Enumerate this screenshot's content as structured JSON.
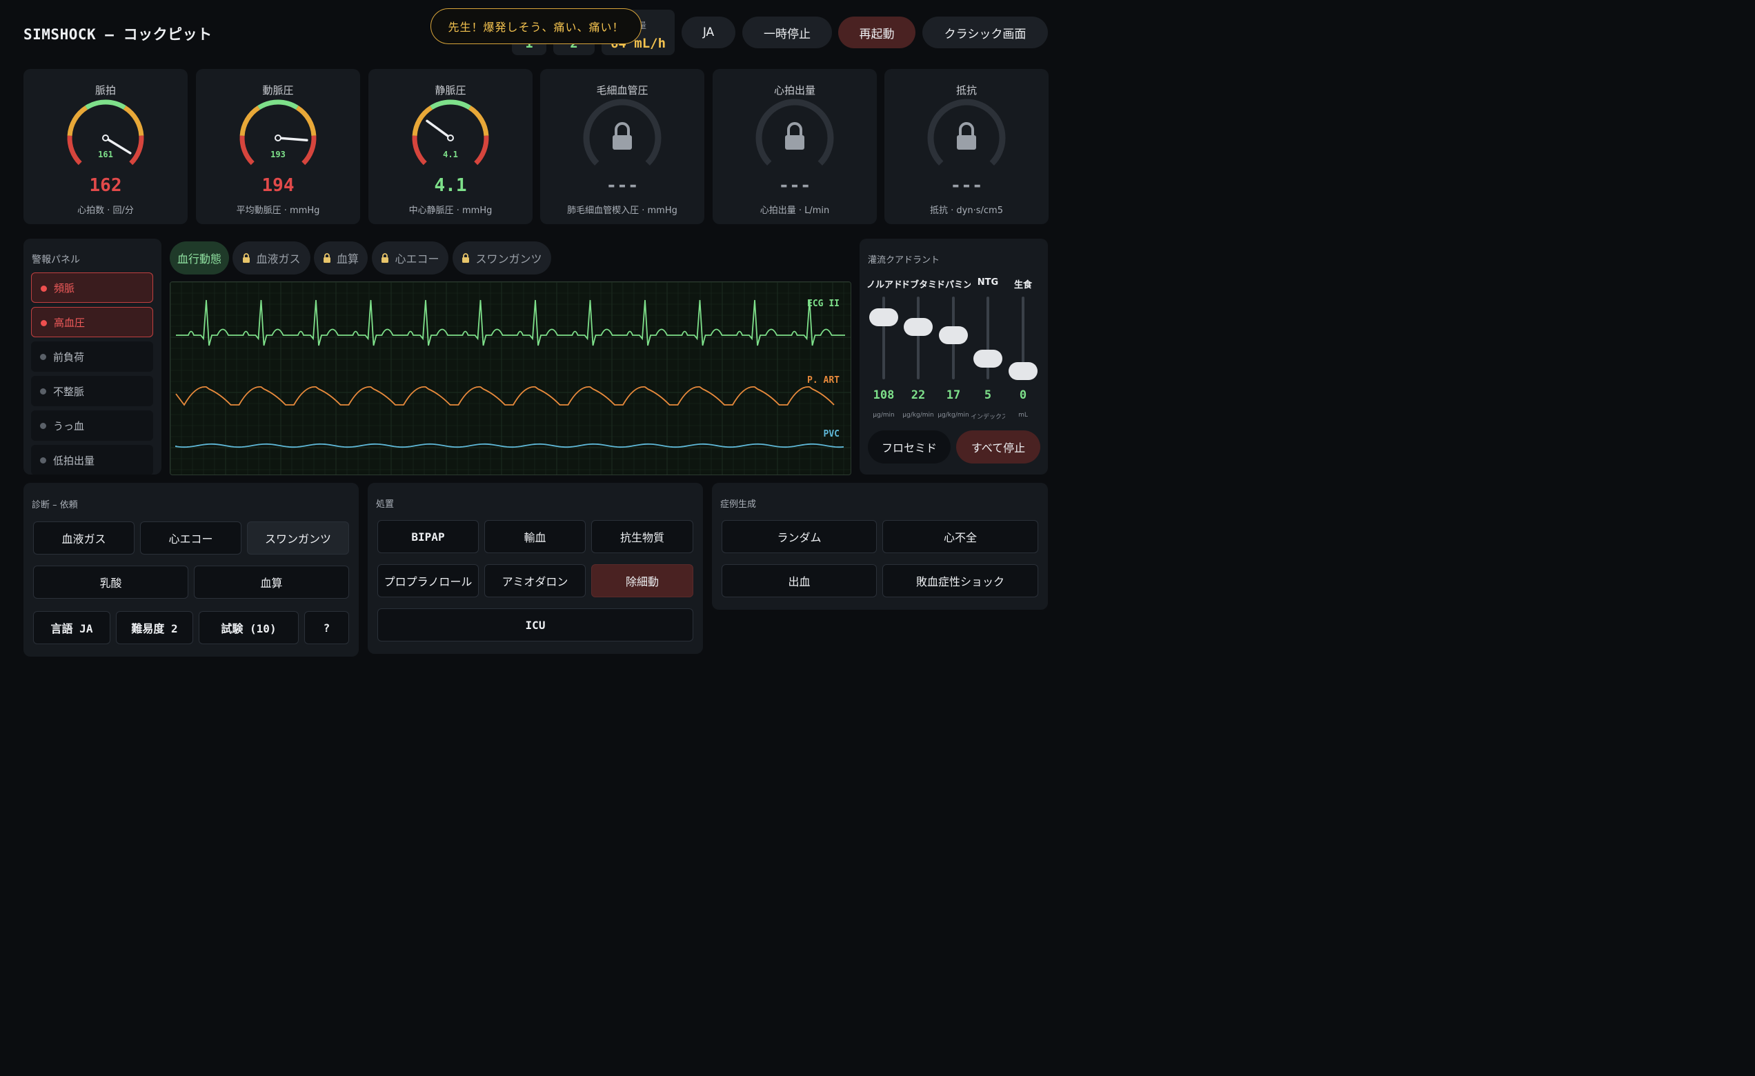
{
  "header": {
    "title": "SIMSHOCK – コックピット",
    "toast": "先生！爆発しそう、痛い、痛い！",
    "readouts": [
      {
        "label": "",
        "value": "1"
      },
      {
        "label": "度",
        "value": "2"
      },
      {
        "label": "尿量",
        "value": "64 mL/h"
      }
    ],
    "buttons": {
      "lang": "JA",
      "pause": "一時停止",
      "restart": "再起動",
      "classic": "クラシック画面"
    }
  },
  "gauges": [
    {
      "title": "脈拍",
      "needle_value": "161",
      "value": "162",
      "unit": "心拍数 · 回/分",
      "locked": false,
      "value_color": "#e24a4a",
      "needle_fraction": 0.95
    },
    {
      "title": "動脈圧",
      "needle_value": "193",
      "value": "194",
      "unit": "平均動脈圧 · mmHg",
      "locked": false,
      "value_color": "#e24a4a",
      "needle_fraction": 0.85
    },
    {
      "title": "静脈圧",
      "needle_value": "4.1",
      "value": "4.1",
      "unit": "中心静脈圧 · mmHg",
      "locked": false,
      "value_color": "#7ee08a",
      "needle_fraction": 0.3
    },
    {
      "title": "毛細血管圧",
      "needle_value": "",
      "value": "---",
      "unit": "肺毛細血管楔入圧 · mmHg",
      "locked": true,
      "value_color": "#9aa0a8"
    },
    {
      "title": "心拍出量",
      "needle_value": "",
      "value": "---",
      "unit": "心拍出量 · L/min",
      "locked": true,
      "value_color": "#9aa0a8"
    },
    {
      "title": "抵抗",
      "needle_value": "",
      "value": "---",
      "unit": "抵抗 · dyn·s/cm5",
      "locked": true,
      "value_color": "#9aa0a8"
    }
  ],
  "alarms": {
    "title": "警報パネル",
    "items": [
      {
        "label": "頻脈",
        "active": true
      },
      {
        "label": "高血圧",
        "active": true
      },
      {
        "label": "前負荷",
        "active": false
      },
      {
        "label": "不整脈",
        "active": false
      },
      {
        "label": "うっ血",
        "active": false
      },
      {
        "label": "低拍出量",
        "active": false
      }
    ]
  },
  "tabs": [
    {
      "label": "血行動態",
      "active": true,
      "locked": false
    },
    {
      "label": "血液ガス",
      "active": false,
      "locked": true
    },
    {
      "label": "血算",
      "active": false,
      "locked": true
    },
    {
      "label": "心エコー",
      "active": false,
      "locked": true
    },
    {
      "label": "スワンガンツ",
      "active": false,
      "locked": true
    }
  ],
  "monitor": {
    "waves": [
      {
        "label": "ECG II",
        "color": "#7ee08a"
      },
      {
        "label": "P. ART",
        "color": "#e88a3c"
      },
      {
        "label": "PVC",
        "color": "#5fb8d8"
      }
    ]
  },
  "perfusion": {
    "title": "灌流クアドラント",
    "sliders": [
      {
        "label": "ノルアドレナリン",
        "value": "108",
        "unit": "µg/min",
        "level": 0.75
      },
      {
        "label": "ドブタミン",
        "value": "22",
        "unit": "µg/kg/min",
        "level": 0.63
      },
      {
        "label": "ドパミン",
        "value": "17",
        "unit": "µg/kg/min",
        "level": 0.53
      },
      {
        "label": "NTG",
        "value": "5",
        "unit": "インデックス",
        "level": 0.25
      },
      {
        "label": "生食",
        "value": "0",
        "unit": "mL",
        "level": 0.1
      }
    ],
    "furosemide": "フロセミド",
    "stop_all": "すべて停止"
  },
  "diagnosis": {
    "title": "診断 – 依頼",
    "row1": [
      "血液ガス",
      "心エコー",
      "スワンガンツ"
    ],
    "row2": [
      "乳酸",
      "血算"
    ],
    "row3": [
      "言語 JA",
      "難易度 2",
      "試験 (10)",
      "?"
    ]
  },
  "treatment": {
    "title": "処置",
    "row1": [
      "BIPAP",
      "輸血",
      "抗生物質"
    ],
    "row2": [
      "プロプラノロール",
      "アミオダロン",
      "除細動"
    ],
    "row3": [
      "ICU"
    ]
  },
  "cases": {
    "title": "症例生成",
    "row1": [
      "ランダム",
      "心不全"
    ],
    "row2": [
      "出血",
      "敗血症性ショック"
    ]
  }
}
